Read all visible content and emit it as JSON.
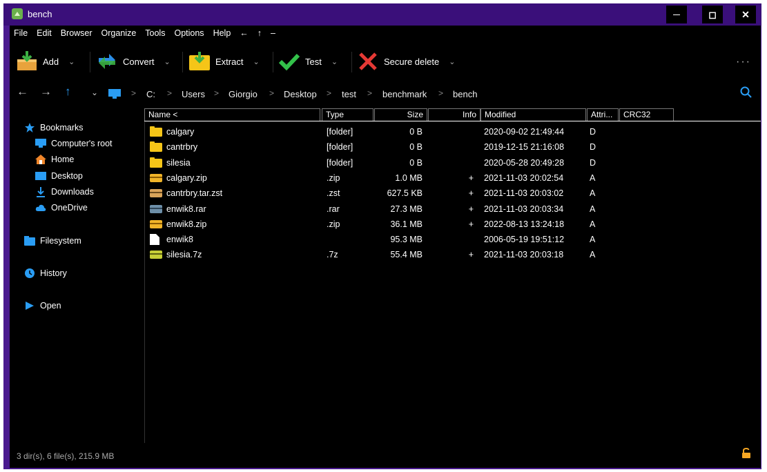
{
  "window": {
    "title": "bench",
    "minimize": "—",
    "maximize": "◻",
    "close": "✕"
  },
  "menu": [
    "File",
    "Edit",
    "Browser",
    "Organize",
    "Tools",
    "Options",
    "Help",
    "←",
    "↑",
    "–"
  ],
  "toolbar": {
    "add": "Add",
    "convert": "Convert",
    "extract": "Extract",
    "test": "Test",
    "secure_delete": "Secure delete",
    "more": "···",
    "chevron": "⌄"
  },
  "address": {
    "back": "←",
    "forward": "→",
    "up": "↑",
    "dropdown": "⌄",
    "crumbs": [
      "C:",
      "Users",
      "Giorgio",
      "Desktop",
      "test",
      "benchmark",
      "bench"
    ],
    "sep": ">"
  },
  "sidebar": {
    "bookmarks": "Bookmarks",
    "items": [
      "Computer's root",
      "Home",
      "Desktop",
      "Downloads",
      "OneDrive"
    ],
    "filesystem": "Filesystem",
    "history": "History",
    "open": "Open"
  },
  "columns": [
    "Name <",
    "Type",
    "Size",
    "Info",
    "Modified",
    "Attri...",
    "CRC32"
  ],
  "files": [
    {
      "name": "calgary",
      "type": "[folder]",
      "size": "0 B",
      "info": "",
      "modified": "2020-09-02 21:49:44",
      "attr": "D",
      "icon": "folder-icon"
    },
    {
      "name": "cantrbry",
      "type": "[folder]",
      "size": "0 B",
      "info": "",
      "modified": "2019-12-15 21:16:08",
      "attr": "D",
      "icon": "folder-icon"
    },
    {
      "name": "silesia",
      "type": "[folder]",
      "size": "0 B",
      "info": "",
      "modified": "2020-05-28 20:49:28",
      "attr": "D",
      "icon": "folder-icon"
    },
    {
      "name": "calgary.zip",
      "type": ".zip",
      "size": "1.0 MB",
      "info": "+",
      "modified": "2021-11-03 20:02:54",
      "attr": "A",
      "icon": "zip-archive-icon"
    },
    {
      "name": "cantrbry.tar.zst",
      "type": ".zst",
      "size": "627.5 KB",
      "info": "+",
      "modified": "2021-11-03 20:03:02",
      "attr": "A",
      "icon": "zst-archive-icon"
    },
    {
      "name": "enwik8.rar",
      "type": ".rar",
      "size": "27.3 MB",
      "info": "+",
      "modified": "2021-11-03 20:03:34",
      "attr": "A",
      "icon": "rar-archive-icon"
    },
    {
      "name": "enwik8.zip",
      "type": ".zip",
      "size": "36.1 MB",
      "info": "+",
      "modified": "2022-08-13 13:24:18",
      "attr": "A",
      "icon": "zip-archive-icon"
    },
    {
      "name": "enwik8",
      "type": "",
      "size": "95.3 MB",
      "info": "",
      "modified": "2006-05-19 19:51:12",
      "attr": "A",
      "icon": "file-icon"
    },
    {
      "name": "silesia.7z",
      "type": ".7z",
      "size": "55.4 MB",
      "info": "+",
      "modified": "2021-11-03 20:03:18",
      "attr": "A",
      "icon": "7z-archive-icon"
    }
  ],
  "status": "3 dir(s), 6 file(s), 215.9 MB",
  "colors": {
    "accent": "#4a1a8f",
    "titlebar": "#3a0f7a",
    "folder": "#f5c518",
    "link": "#4aa3f0"
  }
}
